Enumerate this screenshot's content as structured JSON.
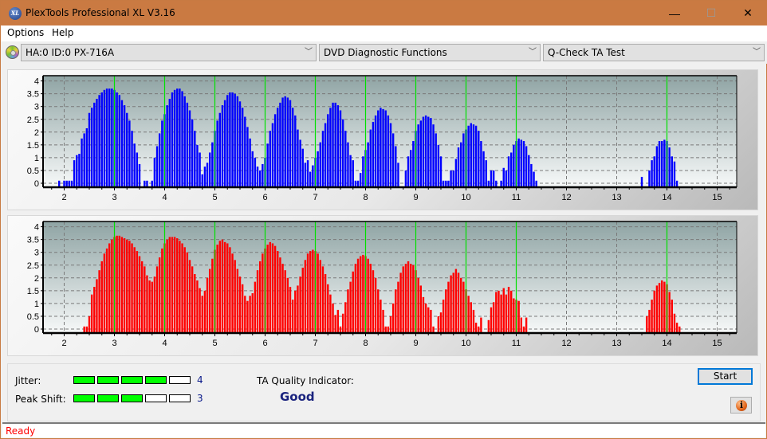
{
  "window": {
    "title": "PlexTools Professional XL V3.16",
    "logo_text": "XL",
    "minimize_glyph": "—",
    "maximize_glyph": "☐",
    "close_glyph": "✕"
  },
  "menu": [
    "Options",
    "Help"
  ],
  "toolbar": {
    "drive": "HA:0 ID:0  PX-716A",
    "function_group": "DVD Diagnostic Functions",
    "test": "Q-Check TA Test",
    "chevron": "﹀"
  },
  "results": {
    "jitter_label": "Jitter:",
    "jitter_value": "4",
    "jitter_level": 4,
    "jitter_max": 5,
    "peak_shift_label": "Peak Shift:",
    "peak_shift_value": "3",
    "peak_shift_level": 3,
    "peak_shift_max": 5,
    "ta_quality_label": "TA Quality Indicator:",
    "ta_quality_value": "Good"
  },
  "buttons": {
    "start": "Start",
    "info": "i"
  },
  "status": "Ready",
  "colors": {
    "top_bars": "#0000ff",
    "bottom_bars": "#ff0000",
    "reference_lines": "#00e000",
    "meter_on": "#00ff00",
    "title_bar": "#ca7a42"
  },
  "chart_data": [
    {
      "type": "bar",
      "name": "top-ta-histogram",
      "title": "",
      "xlabel": "",
      "ylabel": "",
      "xlim": [
        1.6,
        15.5
      ],
      "ylim": [
        0,
        4
      ],
      "x_ticks": [
        2,
        3,
        4,
        5,
        6,
        7,
        8,
        9,
        10,
        11,
        12,
        13,
        14,
        15
      ],
      "y_ticks": [
        "0",
        "0.5",
        "1",
        "1.5",
        "2",
        "2.5",
        "3",
        "3.5",
        "4"
      ],
      "reference_lines": [
        3,
        4,
        5,
        6,
        7,
        8,
        9,
        10,
        11,
        14
      ],
      "grid": true,
      "bar_step": 0.05,
      "series": [
        {
          "start": 1.9,
          "values": [
            0.1,
            0,
            0.1,
            0.1,
            0.1,
            0.1,
            0.9,
            1.1,
            1.15,
            1.75,
            1.95,
            2.15,
            2.75,
            2.95,
            3.15,
            3.3,
            3.45,
            3.55,
            3.65,
            3.7,
            3.7,
            3.7,
            3.65,
            3.55,
            3.45,
            3.25,
            3.05,
            2.75,
            2.45,
            2.05,
            1.55,
            1.2,
            0.75,
            0,
            0.1,
            0.1,
            0,
            0.1,
            1.0,
            1.45,
            1.95,
            2.45,
            2.7,
            3.05,
            3.3,
            3.55,
            3.65,
            3.7,
            3.7,
            3.6,
            3.4,
            3.15,
            2.85,
            2.5,
            2.05,
            1.5,
            1.2,
            0.35,
            0.65,
            0.8,
            1.2,
            1.6,
            2.05,
            2.45,
            2.75,
            3.05,
            3.25,
            3.45,
            3.55,
            3.55,
            3.5,
            3.4,
            3.2,
            2.95,
            2.6,
            2.2,
            1.75,
            1.25,
            1.0,
            0.65,
            0.5,
            0.75,
            1.0,
            1.55,
            2.05,
            2.35,
            2.7,
            2.95,
            3.15,
            3.35,
            3.4,
            3.35,
            3.25,
            2.95,
            2.65,
            2.1,
            1.7,
            1.35,
            0.8,
            0.9,
            0.45,
            0.7,
            1.0,
            1.25,
            1.6,
            2.05,
            2.35,
            2.7,
            2.95,
            3.15,
            3.15,
            3.05,
            2.85,
            2.5,
            2.05,
            1.6,
            1.1,
            0.9,
            0.1,
            0.1,
            0.4,
            1.05,
            1.3,
            1.6,
            2.1,
            2.4,
            2.65,
            2.85,
            2.95,
            2.9,
            2.85,
            2.65,
            2.35,
            1.95,
            1.45,
            0.8,
            0,
            0,
            0.5,
            1.05,
            1.3,
            1.65,
            2.05,
            2.3,
            2.45,
            2.6,
            2.65,
            2.6,
            2.55,
            2.3,
            1.95,
            1.5,
            1.05,
            0.1,
            0.1,
            0.1,
            0.5,
            0.5,
            0.95,
            1.4,
            1.6,
            1.95,
            2.1,
            2.25,
            2.35,
            2.3,
            2.25,
            2.05,
            1.65,
            1.25,
            0.9,
            0.1,
            0.5,
            0.5,
            0.1,
            0,
            0.1,
            0.6,
            0.5,
            1.05,
            1.2,
            1.5,
            1.65,
            1.75,
            1.7,
            1.65,
            1.45,
            1.1,
            0.75,
            0.45,
            0.1
          ]
        },
        {
          "start": 13.5,
          "values": [
            0.25,
            0,
            0,
            0.5,
            0.9,
            1.05,
            1.45,
            1.65,
            1.65,
            1.7,
            1.65,
            1.4,
            1.05,
            0.85,
            0.1
          ]
        }
      ]
    },
    {
      "type": "bar",
      "name": "bottom-ta-histogram",
      "title": "",
      "xlabel": "",
      "ylabel": "",
      "xlim": [
        1.6,
        15.5
      ],
      "ylim": [
        0,
        4
      ],
      "x_ticks": [
        2,
        3,
        4,
        5,
        6,
        7,
        8,
        9,
        10,
        11,
        12,
        13,
        14,
        15
      ],
      "y_ticks": [
        "0",
        "0.5",
        "1",
        "1.5",
        "2",
        "2.5",
        "3",
        "3.5",
        "4"
      ],
      "reference_lines": [
        3,
        4,
        5,
        6,
        7,
        8,
        9,
        10,
        11,
        14
      ],
      "grid": true,
      "bar_step": 0.05,
      "series": [
        {
          "start": 2.4,
          "values": [
            0.1,
            0.1,
            0.5,
            1.35,
            1.65,
            1.95,
            2.3,
            2.65,
            2.95,
            3.15,
            3.35,
            3.5,
            3.6,
            3.65,
            3.65,
            3.6,
            3.55,
            3.5,
            3.45,
            3.35,
            3.2,
            3.05,
            2.85,
            2.65,
            2.45,
            2.1,
            1.9,
            1.85,
            2.05,
            2.45,
            2.8,
            3.15,
            3.35,
            3.5,
            3.6,
            3.6,
            3.6,
            3.55,
            3.45,
            3.35,
            3.2,
            3.0,
            2.7,
            2.45,
            2.15,
            1.9,
            1.6,
            1.3,
            1.5,
            2.0,
            2.35,
            2.75,
            3.1,
            3.3,
            3.45,
            3.5,
            3.4,
            3.35,
            3.2,
            2.95,
            2.7,
            2.35,
            2.05,
            1.75,
            1.3,
            1.1,
            1.3,
            1.4,
            1.85,
            2.3,
            2.65,
            2.95,
            3.15,
            3.3,
            3.4,
            3.35,
            3.25,
            3.05,
            2.8,
            2.55,
            2.3,
            2.0,
            1.65,
            1.15,
            1.5,
            1.7,
            2.05,
            2.4,
            2.7,
            2.95,
            3.05,
            3.1,
            3.05,
            2.95,
            2.7,
            2.45,
            2.15,
            1.75,
            1.35,
            1.0,
            0.55,
            0.75,
            0.1,
            0.6,
            1.05,
            1.55,
            1.85,
            2.25,
            2.55,
            2.75,
            2.85,
            2.9,
            2.85,
            2.75,
            2.55,
            2.3,
            2.0,
            1.55,
            1.15,
            0.75,
            0.1,
            0.1,
            0.5,
            1.0,
            1.55,
            1.85,
            2.2,
            2.45,
            2.55,
            2.65,
            2.55,
            2.5,
            2.3,
            2.0,
            1.7,
            1.25,
            1.0,
            0.85,
            0.75,
            0.1,
            0,
            0.5,
            0.65,
            1.15,
            1.55,
            1.85,
            2.1,
            2.2,
            2.35,
            2.2,
            2.0,
            1.85,
            1.55,
            1.3,
            1.05,
            0.75,
            0.25,
            0.1,
            0.45,
            0,
            0,
            0.35,
            0.85,
            1.05,
            1.45,
            1.5,
            1.35,
            1.6,
            1.35,
            1.65,
            1.5,
            1.2,
            1.15,
            1.1,
            0.45,
            0.1,
            0.45
          ]
        },
        {
          "start": 13.6,
          "values": [
            0.5,
            0.75,
            1.15,
            1.5,
            1.7,
            1.8,
            1.9,
            1.85,
            1.75,
            1.45,
            1.15,
            0.6,
            0.25,
            0.1
          ]
        }
      ]
    }
  ]
}
